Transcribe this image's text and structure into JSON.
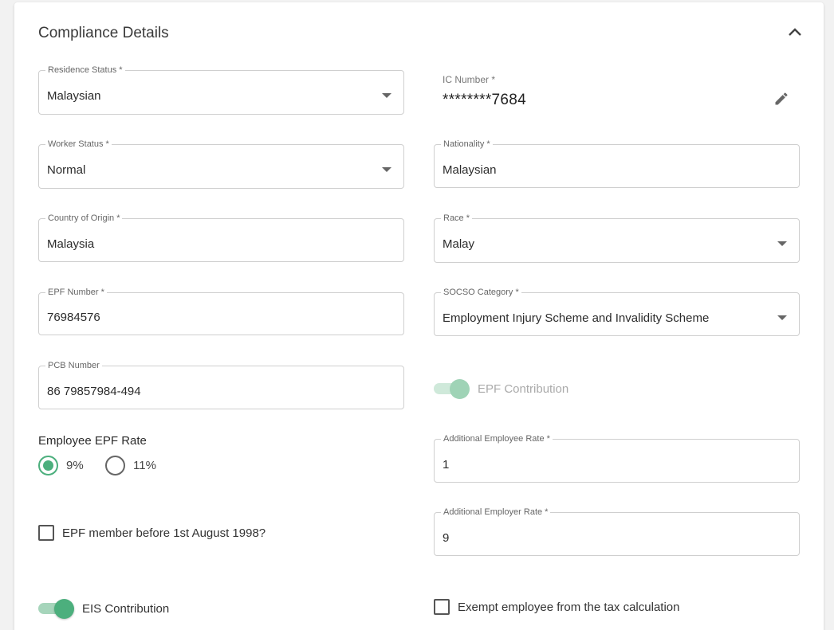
{
  "section": {
    "title": "Compliance Details"
  },
  "fields": {
    "residence_status": {
      "label": "Residence Status *",
      "value": "Malaysian"
    },
    "ic_number": {
      "label": "IC Number *",
      "value": "********7684"
    },
    "worker_status": {
      "label": "Worker Status *",
      "value": "Normal"
    },
    "nationality": {
      "label": "Nationality *",
      "value": "Malaysian"
    },
    "country_of_origin": {
      "label": "Country of Origin *",
      "value": "Malaysia"
    },
    "race": {
      "label": "Race *",
      "value": "Malay"
    },
    "epf_number": {
      "label": "EPF Number *",
      "value": "76984576"
    },
    "socso_category": {
      "label": "SOCSO Category *",
      "value": "Employment Injury Scheme and Invalidity Scheme"
    },
    "pcb_number": {
      "label": "PCB Number",
      "value": "86 79857984-494"
    },
    "additional_employee_rate": {
      "label": "Additional Employee Rate *",
      "value": "1"
    },
    "additional_employer_rate": {
      "label": "Additional Employer Rate *",
      "value": "9"
    }
  },
  "epf_contribution": {
    "label": "EPF Contribution",
    "on": true,
    "disabled": true
  },
  "employee_epf_rate": {
    "label": "Employee EPF Rate",
    "options": [
      {
        "label": "9%",
        "selected": true
      },
      {
        "label": "11%",
        "selected": false
      }
    ]
  },
  "epf_member_before_1998": {
    "label": "EPF member before 1st August 1998?",
    "checked": false
  },
  "eis_contribution": {
    "label": "EIS Contribution",
    "on": true
  },
  "exempt_tax": {
    "label": "Exempt employee from the tax calculation",
    "checked": false
  },
  "icons": {
    "collapse": "chevron-up-icon",
    "edit": "pencil-icon",
    "dropdown": "caret-down-icon"
  },
  "colors": {
    "accent": "#4caf7d",
    "accent_light": "#a6d5bb"
  }
}
